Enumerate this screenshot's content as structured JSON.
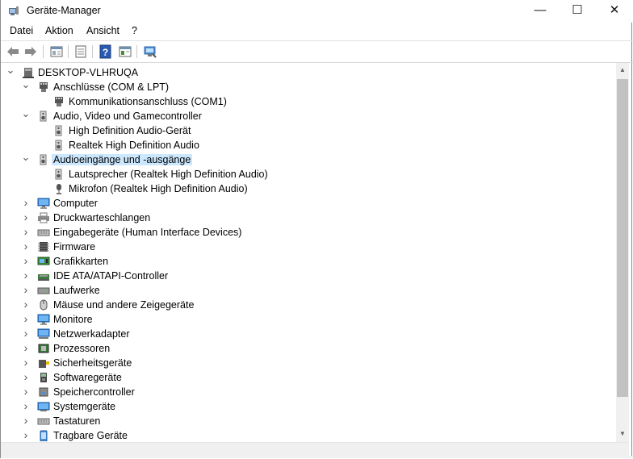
{
  "window": {
    "title": "Geräte-Manager",
    "min": "—",
    "max": "☐",
    "close": "✕"
  },
  "menu": [
    "Datei",
    "Aktion",
    "Ansicht",
    "?"
  ],
  "toolbar": [
    "back-icon",
    "forward-icon",
    "properties-icon",
    "update-driver-icon",
    "help-icon",
    "view-icon",
    "scan-hardware-icon"
  ],
  "tree": [
    {
      "level": 0,
      "expand": "open",
      "label": "DESKTOP-VLHRUQA",
      "icon": "computer-tower-icon"
    },
    {
      "level": 1,
      "expand": "open",
      "label": "Anschlüsse (COM & LPT)",
      "icon": "port-icon"
    },
    {
      "level": 2,
      "expand": "none",
      "label": "Kommunikationsanschluss (COM1)",
      "icon": "port-icon"
    },
    {
      "level": 1,
      "expand": "open",
      "label": "Audio, Video und Gamecontroller",
      "icon": "speaker-icon"
    },
    {
      "level": 2,
      "expand": "none",
      "label": "High Definition Audio-Gerät",
      "icon": "speaker-icon"
    },
    {
      "level": 2,
      "expand": "none",
      "label": "Realtek High Definition Audio",
      "icon": "speaker-icon"
    },
    {
      "level": 1,
      "expand": "open",
      "label": "Audioeingänge und -ausgänge",
      "icon": "speaker-icon",
      "selected": true
    },
    {
      "level": 2,
      "expand": "none",
      "label": "Lautsprecher (Realtek High Definition Audio)",
      "icon": "speaker-icon"
    },
    {
      "level": 2,
      "expand": "none",
      "label": "Mikrofon (Realtek High Definition Audio)",
      "icon": "microphone-icon"
    },
    {
      "level": 1,
      "expand": "closed",
      "label": "Computer",
      "icon": "monitor-icon"
    },
    {
      "level": 1,
      "expand": "closed",
      "label": "Druckwarteschlangen",
      "icon": "printer-icon"
    },
    {
      "level": 1,
      "expand": "closed",
      "label": "Eingabegeräte (Human Interface Devices)",
      "icon": "keyboard-icon"
    },
    {
      "level": 1,
      "expand": "closed",
      "label": "Firmware",
      "icon": "chip-icon"
    },
    {
      "level": 1,
      "expand": "closed",
      "label": "Grafikkarten",
      "icon": "display-adapter-icon"
    },
    {
      "level": 1,
      "expand": "closed",
      "label": "IDE ATA/ATAPI-Controller",
      "icon": "ide-controller-icon"
    },
    {
      "level": 1,
      "expand": "closed",
      "label": "Laufwerke",
      "icon": "disk-drive-icon"
    },
    {
      "level": 1,
      "expand": "closed",
      "label": "Mäuse und andere Zeigegeräte",
      "icon": "mouse-icon"
    },
    {
      "level": 1,
      "expand": "closed",
      "label": "Monitore",
      "icon": "monitor-icon"
    },
    {
      "level": 1,
      "expand": "closed",
      "label": "Netzwerkadapter",
      "icon": "network-icon"
    },
    {
      "level": 1,
      "expand": "closed",
      "label": "Prozessoren",
      "icon": "processor-icon"
    },
    {
      "level": 1,
      "expand": "closed",
      "label": "Sicherheitsgeräte",
      "icon": "security-device-icon"
    },
    {
      "level": 1,
      "expand": "closed",
      "label": "Softwaregeräte",
      "icon": "software-device-icon"
    },
    {
      "level": 1,
      "expand": "closed",
      "label": "Speichercontroller",
      "icon": "storage-controller-icon"
    },
    {
      "level": 1,
      "expand": "closed",
      "label": "Systemgeräte",
      "icon": "system-devices-icon"
    },
    {
      "level": 1,
      "expand": "closed",
      "label": "Tastaturen",
      "icon": "keyboard-icon"
    },
    {
      "level": 1,
      "expand": "closed",
      "label": "Tragbare Geräte",
      "icon": "portable-device-icon"
    }
  ],
  "colors": {
    "selection": "#cce8ff",
    "accent": "#0078d7"
  }
}
